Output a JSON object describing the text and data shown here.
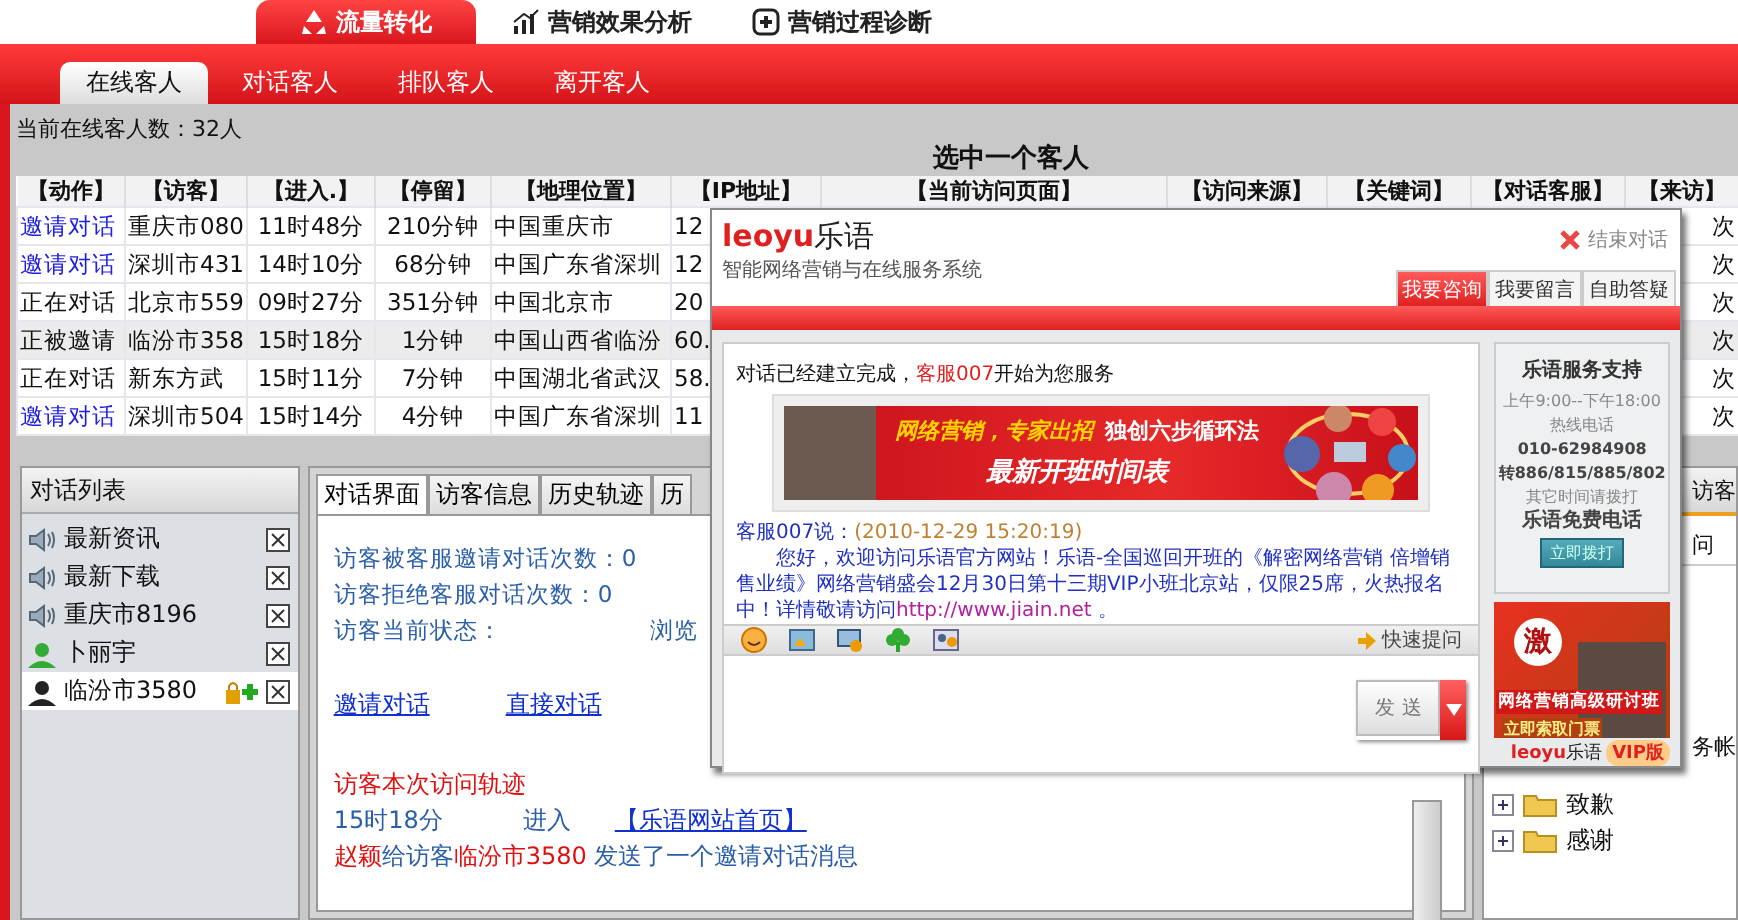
{
  "top_tabs": [
    {
      "label": "流量转化",
      "selected": true
    },
    {
      "label": "营销效果分析",
      "selected": false
    },
    {
      "label": "营销过程诊断",
      "selected": false
    }
  ],
  "sub_tabs": [
    {
      "label": "在线客人",
      "selected": true
    },
    {
      "label": "对话客人",
      "selected": false
    },
    {
      "label": "排队客人",
      "selected": false
    },
    {
      "label": "离开客人",
      "selected": false
    }
  ],
  "online_count": "当前在线客人数：32人",
  "selection_hint": "选中一个客人",
  "table": {
    "columns": [
      "【动作】",
      "【访客】",
      "【进入.】",
      "【停留】",
      "【地理位置】",
      "【IP地址】",
      "【当前访问页面】",
      "【访问来源】",
      "【关键词】",
      "【对话客服】",
      "【来访】"
    ],
    "rows": [
      {
        "action": "邀请对话",
        "kind": "link",
        "visitor": "重庆市080",
        "entered": "11时48分",
        "stay": "210分钟",
        "location": "中国重庆市",
        "ip": "12",
        "visits": "次",
        "selected": false
      },
      {
        "action": "邀请对话",
        "kind": "link",
        "visitor": "深圳市431",
        "entered": "14时10分",
        "stay": "68分钟",
        "location": "中国广东省深圳",
        "ip": "12",
        "visits": "次",
        "selected": false
      },
      {
        "action": "正在对话",
        "kind": "text",
        "visitor": "北京市559",
        "entered": "09时27分",
        "stay": "351分钟",
        "location": "中国北京市",
        "ip": "20",
        "visits": "次",
        "selected": false
      },
      {
        "action": "正被邀请",
        "kind": "text",
        "visitor": "临汾市358",
        "entered": "15时18分",
        "stay": "1分钟",
        "location": "中国山西省临汾",
        "ip": "60.",
        "visits": "次",
        "selected": true
      },
      {
        "action": "正在对话",
        "kind": "text",
        "visitor": "新东方武",
        "entered": "15时11分",
        "stay": "7分钟",
        "location": "中国湖北省武汉",
        "ip": "58.",
        "visits": "次",
        "selected": false
      },
      {
        "action": "邀请对话",
        "kind": "link",
        "visitor": "深圳市504",
        "entered": "15时14分",
        "stay": "4分钟",
        "location": "中国广东省深圳",
        "ip": "11",
        "visits": "次",
        "selected": false
      }
    ]
  },
  "conversation_list": {
    "title": "对话列表",
    "items": [
      {
        "label": "最新资讯",
        "kind": "speaker",
        "selected": false,
        "locked": false
      },
      {
        "label": "最新下载",
        "kind": "speaker",
        "selected": false,
        "locked": false
      },
      {
        "label": "重庆市8196",
        "kind": "speaker",
        "selected": false,
        "locked": false
      },
      {
        "label": "卜丽宇",
        "kind": "agent",
        "selected": false,
        "locked": false
      },
      {
        "label": "临汾市3580",
        "kind": "visitor",
        "selected": true,
        "locked": true
      }
    ]
  },
  "detail_panel": {
    "tabs": [
      {
        "label": "对话界面",
        "selected": true
      },
      {
        "label": "访客信息",
        "selected": false
      },
      {
        "label": "历史轨迹",
        "selected": false
      },
      {
        "label": "历",
        "selected": false
      }
    ],
    "stats": [
      {
        "label": "访客被客服邀请对话次数：",
        "value": "0",
        "kind": "inline"
      },
      {
        "label": "访客拒绝客服对话次数：",
        "value": "0",
        "kind": "inline"
      },
      {
        "label": "访客当前状态：",
        "value": "浏览",
        "kind": "column"
      }
    ],
    "links": [
      "邀请对话",
      "直接对话"
    ],
    "trail_title": "访客本次访问轨迹",
    "trail": [
      {
        "time": "15时18分",
        "event": "进入",
        "page": "【乐语网站首页】"
      }
    ],
    "log": [
      {
        "text": "赵颖",
        "highlight": true
      },
      {
        "text": "给访客",
        "highlight": false
      },
      {
        "text": "临汾市3580",
        "highlight": true
      },
      {
        "text": " 发送了一个邀请对话消息",
        "highlight": false
      }
    ]
  },
  "right_panel": {
    "header": "访客",
    "field": "问",
    "label": "务帐",
    "tree": [
      {
        "label": "致歉",
        "expanded": false
      },
      {
        "label": "感谢",
        "expanded": false
      }
    ]
  },
  "popup": {
    "logo": "leoyu",
    "logo_cn": "乐语",
    "tagline": "智能网络营销与在线服务系统",
    "close": "结束对话",
    "tabs": [
      {
        "label": "我要咨询",
        "selected": true
      },
      {
        "label": "我要留言",
        "selected": false
      },
      {
        "label": "自助答疑",
        "selected": false
      }
    ],
    "status_line": [
      {
        "text": "对话已经建立完成，",
        "highlight": false
      },
      {
        "text": "客服007",
        "highlight": true
      },
      {
        "text": "开始为您服务",
        "highlight": false
      }
    ],
    "banner": {
      "slogan": "网络营销，专家出招",
      "method": "独创六步循环法",
      "title": "最新开班时间表"
    },
    "message": {
      "sender": "客服007说：",
      "time": "(2010-12-29 15:20:19)",
      "body": "您好，欢迎访问乐语官方网站！乐语-全国巡回开班的《解密网络营销 倍增销售业绩》网络营销盛会12月30日第十三期VIP小班北京站，仅限25席，火热报名中！详情敬请访问",
      "link": "http://www.jiain.net",
      "tail": " 。"
    },
    "quick_ask": "快速提问",
    "send": "发 送",
    "support": {
      "title": "乐语服务支持",
      "lines": [
        {
          "text": "上午9:00--下午18:00",
          "strong": false
        },
        {
          "text": "热线电话",
          "strong": false
        },
        {
          "text": "010-62984908",
          "strong": true
        },
        {
          "text": "转886/815/885/802",
          "strong": true
        },
        {
          "text": "其它时间请拨打",
          "strong": false
        },
        {
          "text": "乐语免费电话",
          "strong": true
        }
      ],
      "button": "立即拨打"
    },
    "ad": {
      "badge": "激",
      "title": "网络营销高级研讨班",
      "cta": "立即索取门票"
    },
    "footer": {
      "brand": "leoyu",
      "brand_cn": "乐语",
      "edition": "VIP版"
    }
  }
}
